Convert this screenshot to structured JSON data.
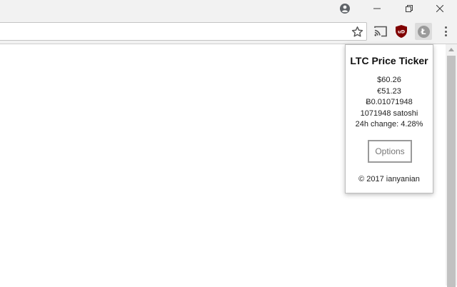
{
  "window": {
    "icons": [
      "profile-icon",
      "minimize-icon",
      "maximize-icon",
      "close-icon"
    ]
  },
  "toolbar": {
    "address_value": "",
    "icons": [
      "star-icon",
      "cast-icon",
      "ublock-origin-icon",
      "litecoin-icon",
      "menu-icon"
    ],
    "ublock_badge": "uD",
    "ltc_glyph": "Ł"
  },
  "popup": {
    "title": "LTC Price Ticker",
    "prices": {
      "usd": "$60.26",
      "eur": "€51.23",
      "btc": "Ƀ0.01071948",
      "satoshi": "1071948 satoshi",
      "change": "24h change: 4.28%"
    },
    "options_label": "Options",
    "copyright": "© 2017 ianyanian"
  },
  "colors": {
    "chrome_frame": "#f2f2f2",
    "ublock_red": "#800000",
    "ltc_gray": "#9a9a9a"
  }
}
